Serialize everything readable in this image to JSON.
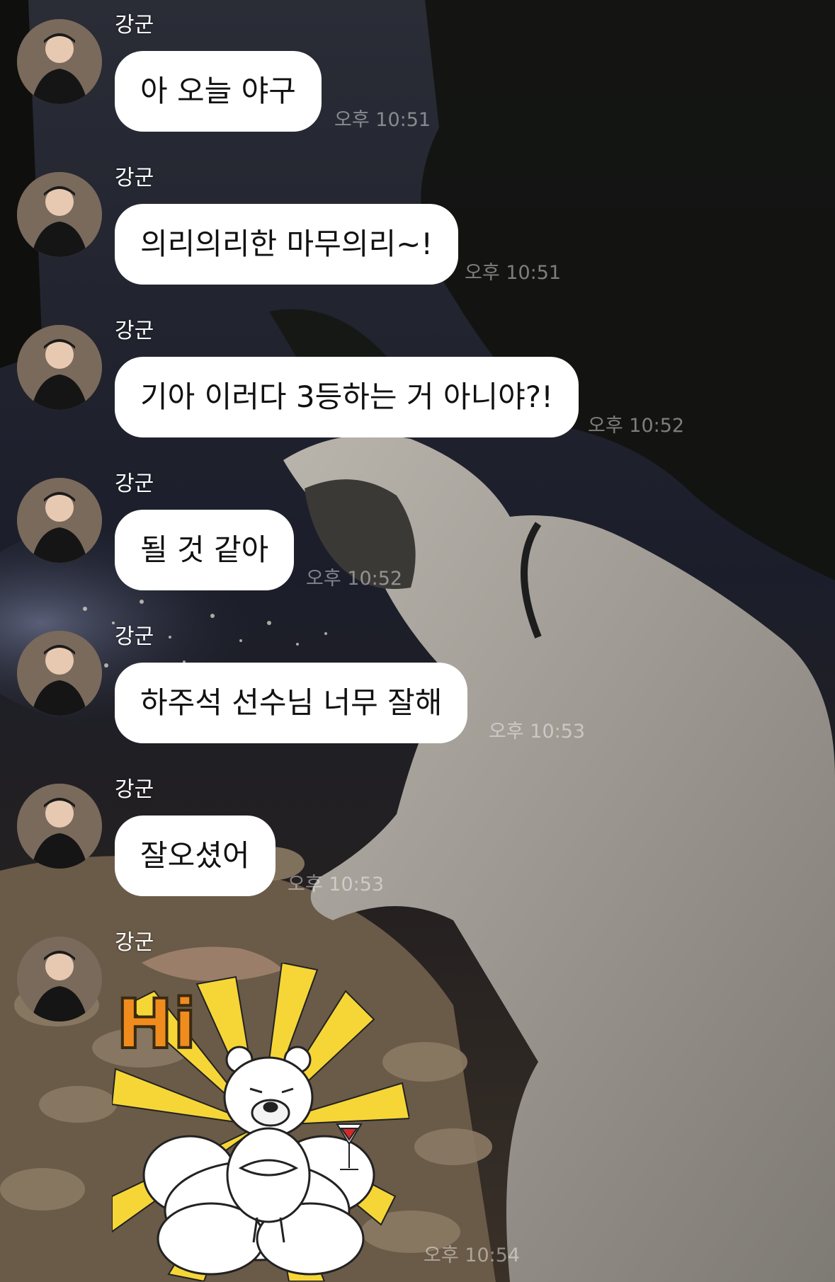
{
  "chat": {
    "sender_name": "강군",
    "messages": [
      {
        "text": "아 오늘 야구",
        "time": "오후 10:51"
      },
      {
        "text": "의리의리한 마무의리~!",
        "time": "오후 10:51"
      },
      {
        "text": "기아 이러다 3등하는 거 아니야?!",
        "time": "오후 10:52"
      },
      {
        "text": "될 것 같아",
        "time": "오후 10:52"
      },
      {
        "text": "하주석 선수님 너무 잘해",
        "time": "오후 10:53"
      },
      {
        "text": "잘오셨어",
        "time": "오후 10:53"
      }
    ],
    "sticker": {
      "text": "Hi",
      "time": "오후 10:54",
      "icon": "bear-sticker-icon"
    }
  },
  "colors": {
    "bubble": "#ffffff",
    "sticker_rays": "#f6d637",
    "hi_text": "#f08c1e"
  }
}
